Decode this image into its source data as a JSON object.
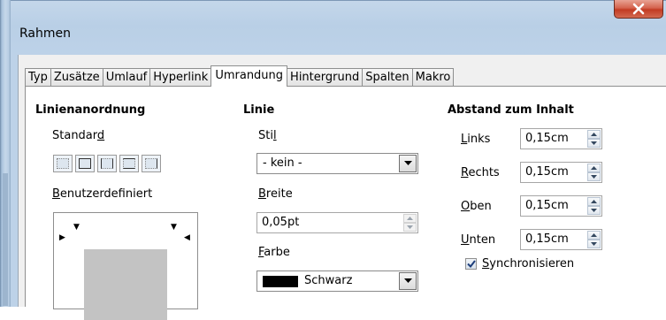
{
  "window": {
    "title": "Rahmen",
    "close_symbol": "x"
  },
  "tabs": [
    {
      "label": "Typ",
      "active": false
    },
    {
      "label": "Zusätze",
      "active": false
    },
    {
      "label": "Umlauf",
      "active": false
    },
    {
      "label": "Hyperlink",
      "active": false
    },
    {
      "label": "Umrandung",
      "active": true
    },
    {
      "label": "Hintergrund",
      "active": false
    },
    {
      "label": "Spalten",
      "active": false
    },
    {
      "label": "Makro",
      "active": false
    }
  ],
  "line_arrangement": {
    "heading": "Linienanordnung",
    "default_label_pre": "Standar",
    "default_label_ul": "d",
    "user_defined_label_ul": "B",
    "user_defined_label_post": "enutzerdefiniert"
  },
  "line": {
    "heading": "Linie",
    "style_label_pre": "Sti",
    "style_label_ul": "l",
    "style_value": "- kein -",
    "width_label_ul": "B",
    "width_label_post": "reite",
    "width_value": "0,05pt",
    "color_label_ul": "F",
    "color_label_post": "arbe",
    "color_value": "Schwarz",
    "color_hex": "#000000"
  },
  "spacing": {
    "heading": "Abstand zum Inhalt",
    "left_label_ul": "L",
    "left_label_post": "inks",
    "left_value": "0,15cm",
    "right_label_ul": "R",
    "right_label_post": "echts",
    "right_value": "0,15cm",
    "top_label_ul": "O",
    "top_label_post": "ben",
    "top_value": "0,15cm",
    "bottom_label_ul": "U",
    "bottom_label_post": "nten",
    "bottom_value": "0,15cm",
    "sync_label_ul": "S",
    "sync_label_post": "ynchronisieren",
    "sync_checked": true
  }
}
